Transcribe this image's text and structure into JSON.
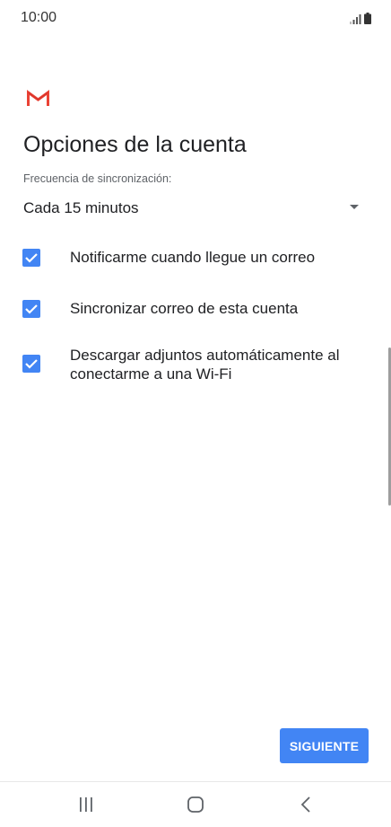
{
  "status_bar": {
    "time": "10:00",
    "icons": [
      "signal-icon",
      "battery-icon"
    ]
  },
  "header": {
    "logo": "gmail-logo",
    "title": "Opciones de la cuenta"
  },
  "sync": {
    "label": "Frecuencia de sincronización:",
    "selected": "Cada 15 minutos"
  },
  "options": [
    {
      "label": "Notificarme cuando llegue un correo",
      "checked": true
    },
    {
      "label": "Sincronizar correo de esta cuenta",
      "checked": true
    },
    {
      "label": "Descargar adjuntos automáticamente al conectarme a una Wi-Fi",
      "checked": true
    }
  ],
  "actions": {
    "next_label": "SIGUIENTE"
  },
  "navigation": {
    "buttons": [
      "recent-apps-icon",
      "home-icon",
      "back-icon"
    ]
  },
  "colors": {
    "accent": "#4285f4",
    "gmail_red": "#ea4335",
    "text": "#202124",
    "secondary_text": "#5f6368"
  }
}
